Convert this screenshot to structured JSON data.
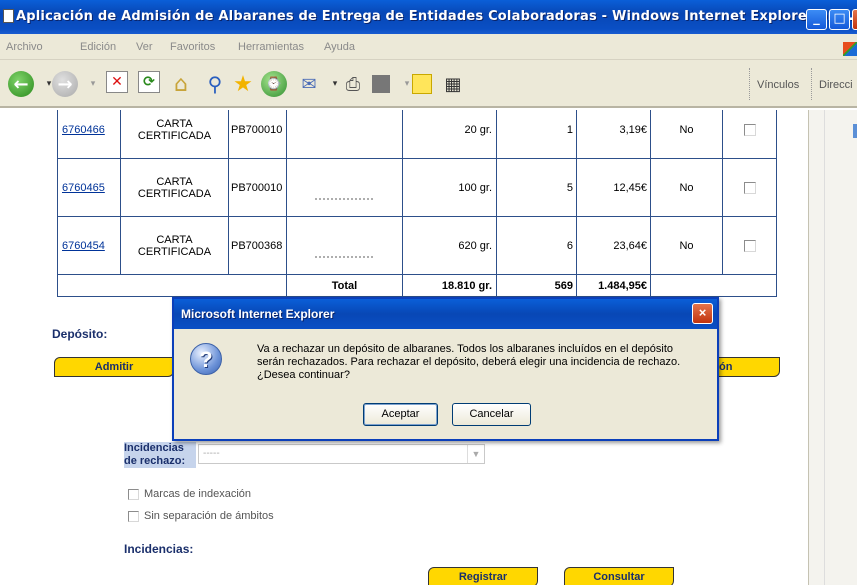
{
  "window": {
    "title": "Aplicación de Admisión de Albaranes de Entrega de Entidades Colaboradoras - Windows Internet Explorer pro...",
    "minimize": "_",
    "maximize": "□",
    "close": "×"
  },
  "menu": {
    "items": [
      "Archivo",
      "Edición",
      "Ver",
      "Favoritos",
      "Herramientas",
      "Ayuda"
    ]
  },
  "toolbar": {
    "links_label": "Vínculos",
    "address_label": "Direcci"
  },
  "table": {
    "rows": [
      {
        "num": "6760466",
        "product": "CARTA CERTIFICADA",
        "code": "PB700010",
        "weight": "20 gr.",
        "qty": "1",
        "amount": "3,19€",
        "result": "No"
      },
      {
        "num": "6760465",
        "product": "CARTA CERTIFICADA",
        "code": "PB700010",
        "weight": "100 gr.",
        "qty": "5",
        "amount": "12,45€",
        "result": "No"
      },
      {
        "num": "6760454",
        "product": "CARTA CERTIFICADA",
        "code": "PB700368",
        "weight": "620 gr.",
        "qty": "6",
        "amount": "23,64€",
        "result": "No"
      }
    ],
    "total": {
      "label": "Total",
      "weight": "18.810 gr.",
      "qty": "569",
      "amount": "1.484,95€"
    }
  },
  "form": {
    "deposito_label": "Depósito:",
    "admitir_label": "Admitir",
    "partial_button_label": "ón",
    "incidencias_rechazo_label_1": "Incidencias",
    "incidencias_rechazo_label_2": "de rechazo:",
    "select_value": "-----",
    "marcas_label": "Marcas de indexación",
    "sin_separacion_label": "Sin separación de ámbitos",
    "incidencias_label": "Incidencias:",
    "registrar_label": "Registrar",
    "consultar_label": "Consultar"
  },
  "dialog": {
    "title": "Microsoft Internet Explorer",
    "icon": "question-icon",
    "message_1": "Va a rechazar un depósito de albaranes. Todos los albaranes incluídos en el depósito",
    "message_2": "serán rechazados. Para rechazar el depósito, deberá elegir una incidencia de rechazo.",
    "message_3": "¿Desea continuar?",
    "accept_label": "Aceptar",
    "cancel_label": "Cancelar",
    "close": "×",
    "question_mark": "?"
  }
}
